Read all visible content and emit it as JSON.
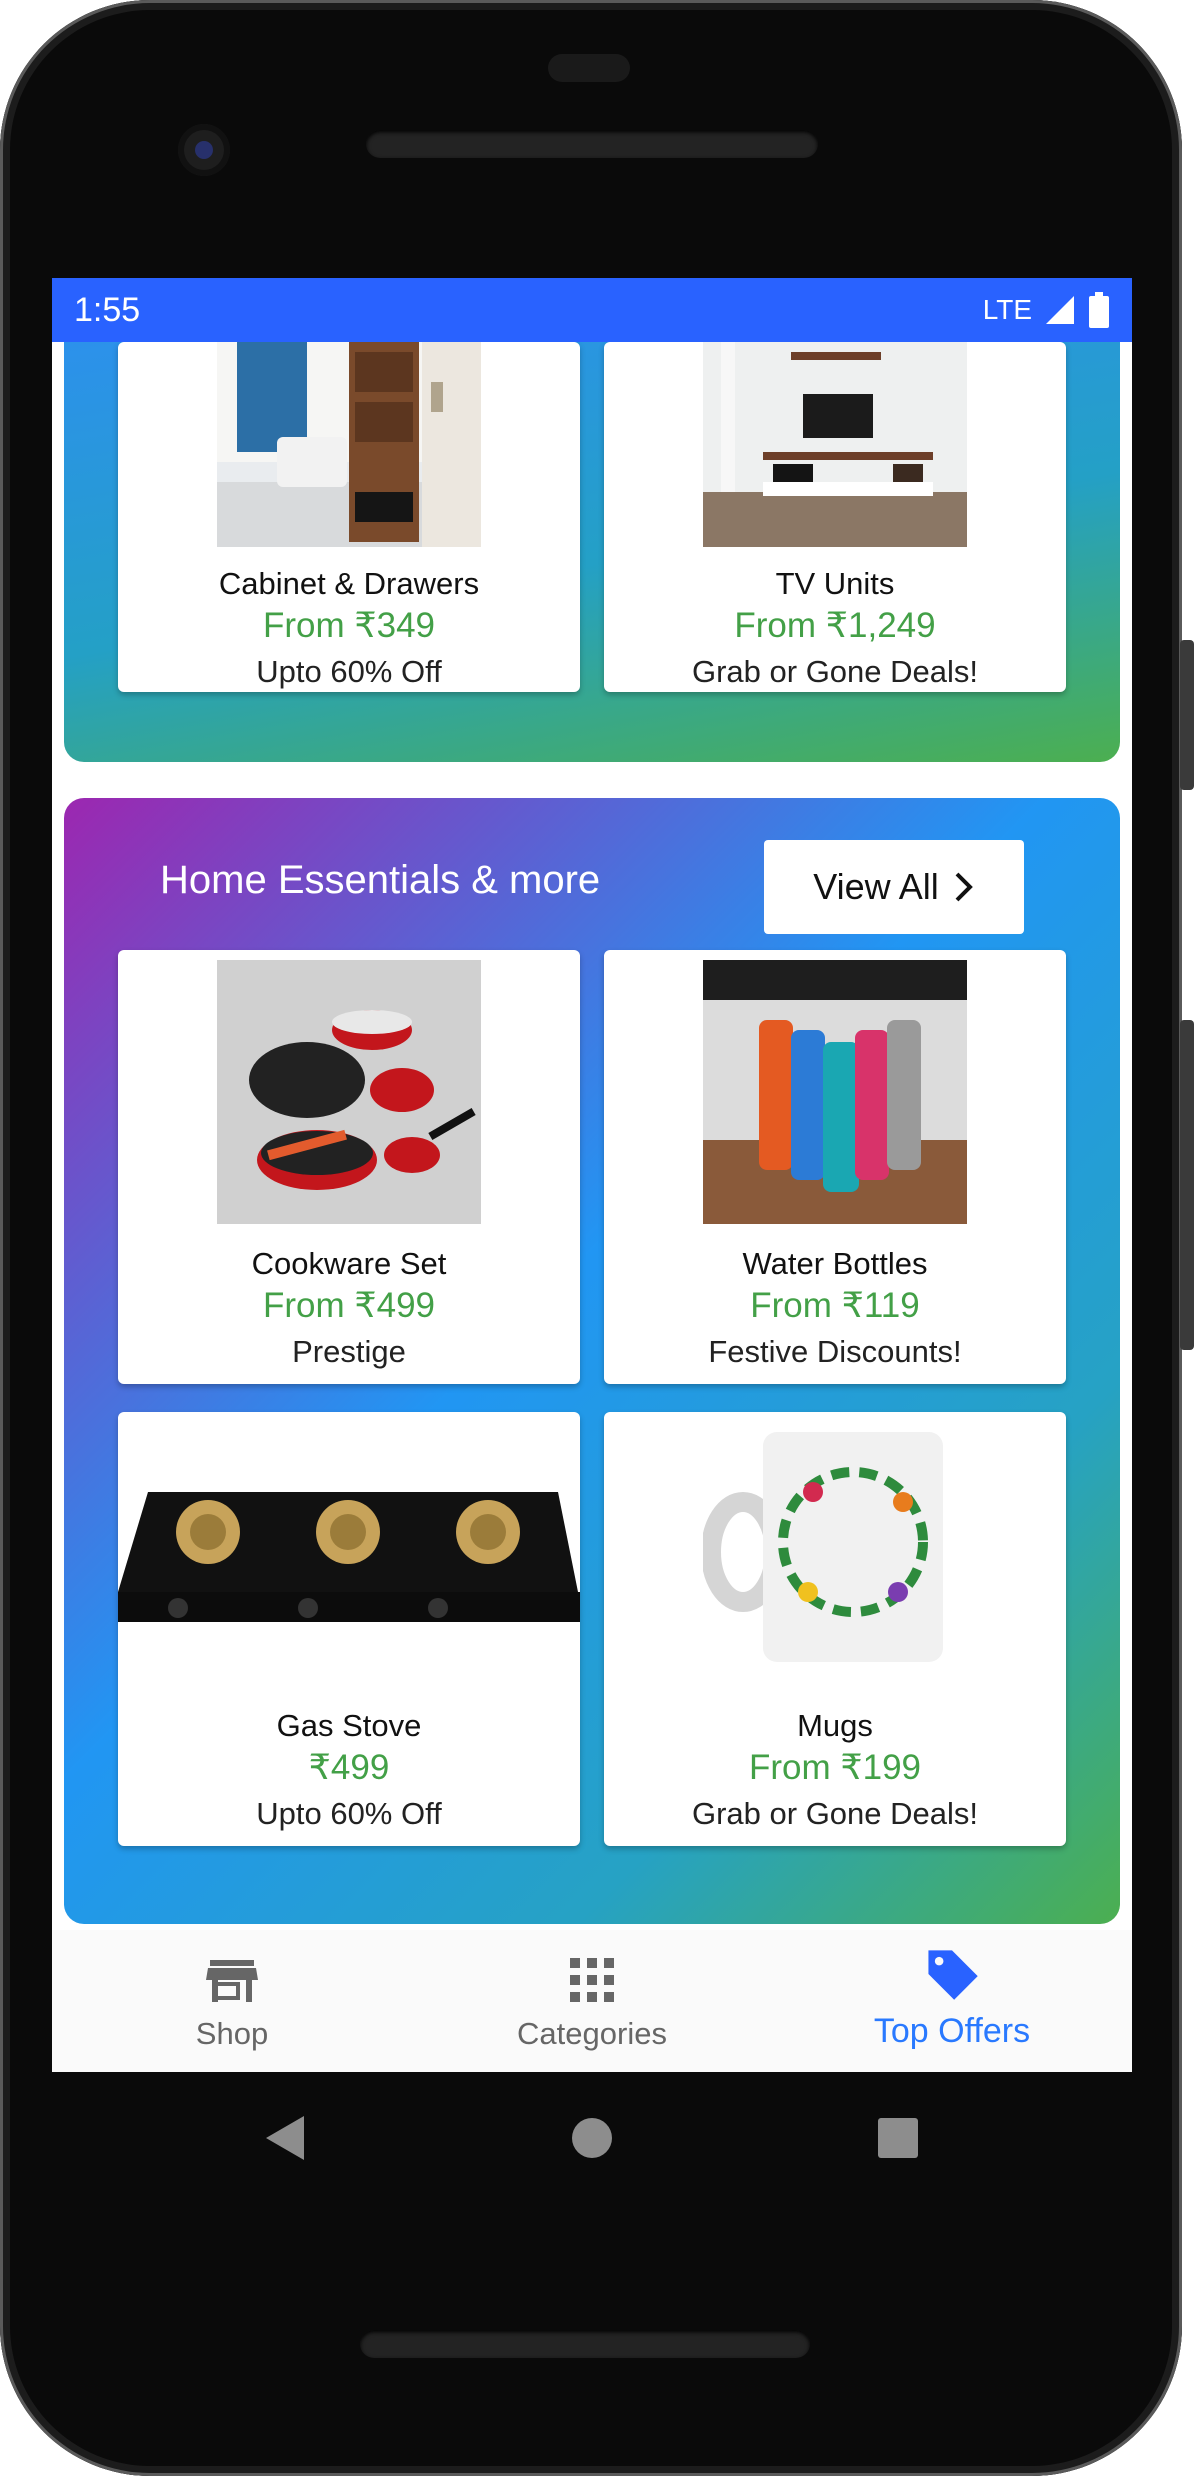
{
  "status_bar": {
    "time": "1:55",
    "network": "LTE"
  },
  "top_section": {
    "cards": [
      {
        "name": "Cabinet & Drawers",
        "price": "From ₹349",
        "note": "Upto 60% Off",
        "image": "cabinet-drawers-photo"
      },
      {
        "name": "TV Units",
        "price": "From ₹1,249",
        "note": "Grab or Gone Deals!",
        "image": "tv-unit-photo"
      }
    ]
  },
  "home_section": {
    "title": "Home Essentials & more",
    "view_all_label": "View All",
    "cards": [
      {
        "name": "Cookware Set",
        "price": "From ₹499",
        "note": "Prestige",
        "image": "cookware-photo"
      },
      {
        "name": "Water Bottles",
        "price": "From ₹119",
        "note": "Festive Discounts!",
        "image": "bottles-photo"
      },
      {
        "name": "Gas Stove",
        "price": "₹499",
        "note": "Upto 60% Off",
        "image": "gas-stove-photo"
      },
      {
        "name": "Mugs",
        "price": "From ₹199",
        "note": "Grab or Gone Deals!",
        "image": "mug-photo"
      }
    ]
  },
  "bottom_nav": {
    "items": [
      {
        "label": "Shop",
        "icon": "store-icon",
        "active": false
      },
      {
        "label": "Categories",
        "icon": "grid-icon",
        "active": false
      },
      {
        "label": "Top Offers",
        "icon": "tag-icon",
        "active": true
      }
    ]
  },
  "colors": {
    "status_bar": "#2962ff",
    "price_green": "#43a047",
    "active_tab": "#2979ff"
  }
}
